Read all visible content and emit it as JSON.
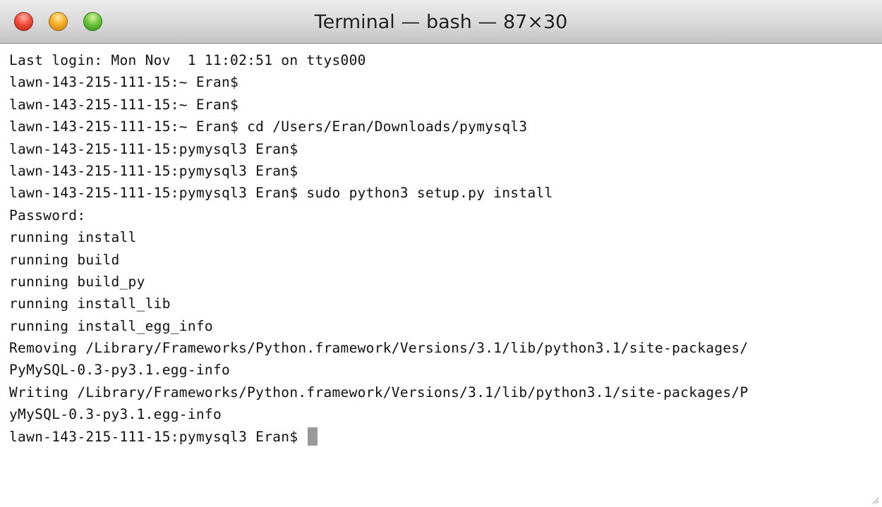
{
  "window": {
    "title": "Terminal — bash — 87×30"
  },
  "terminal": {
    "lines": [
      "Last login: Mon Nov  1 11:02:51 on ttys000",
      "lawn-143-215-111-15:~ Eran$",
      "lawn-143-215-111-15:~ Eran$",
      "lawn-143-215-111-15:~ Eran$ cd /Users/Eran/Downloads/pymysql3",
      "lawn-143-215-111-15:pymysql3 Eran$",
      "lawn-143-215-111-15:pymysql3 Eran$",
      "lawn-143-215-111-15:pymysql3 Eran$ sudo python3 setup.py install",
      "Password:",
      "running install",
      "running build",
      "running build_py",
      "running install_lib",
      "running install_egg_info",
      "Removing /Library/Frameworks/Python.framework/Versions/3.1/lib/python3.1/site-packages/",
      "PyMySQL-0.3-py3.1.egg-info",
      "Writing /Library/Frameworks/Python.framework/Versions/3.1/lib/python3.1/site-packages/P",
      "yMySQL-0.3-py3.1.egg-info"
    ],
    "prompt": "lawn-143-215-111-15:pymysql3 Eran$ "
  }
}
